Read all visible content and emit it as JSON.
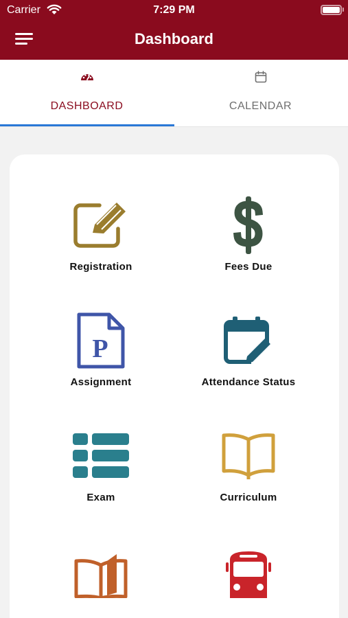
{
  "status_bar": {
    "carrier": "Carrier",
    "time": "7:29 PM"
  },
  "header": {
    "title": "Dashboard",
    "menu_icon": "hamburger-menu-icon",
    "background": "#8a0b1e"
  },
  "tabs": [
    {
      "label": "DASHBOARD",
      "icon": "dashboard-gauge-icon",
      "active": true
    },
    {
      "label": "CALENDAR",
      "icon": "calendar-icon",
      "active": false
    }
  ],
  "accent": {
    "tab_indicator": "#2a78d6"
  },
  "tiles": [
    {
      "label": "Registration",
      "icon": "edit-pencil-icon",
      "color": "#9a7d2e"
    },
    {
      "label": "Fees Due",
      "icon": "dollar-sign-icon",
      "color": "#3d5443"
    },
    {
      "label": "Assignment",
      "icon": "document-p-icon",
      "color": "#3f55a8"
    },
    {
      "label": "Attendance Status",
      "icon": "calendar-edit-icon",
      "color": "#1f5f75"
    },
    {
      "label": "Exam",
      "icon": "list-icon",
      "color": "#2a7f8d"
    },
    {
      "label": "Curriculum",
      "icon": "open-book-icon",
      "color": "#d0a03c"
    },
    {
      "label": "",
      "icon": "books-icon",
      "color": "#c0602a"
    },
    {
      "label": "",
      "icon": "bus-icon",
      "color": "#c9242a"
    }
  ]
}
